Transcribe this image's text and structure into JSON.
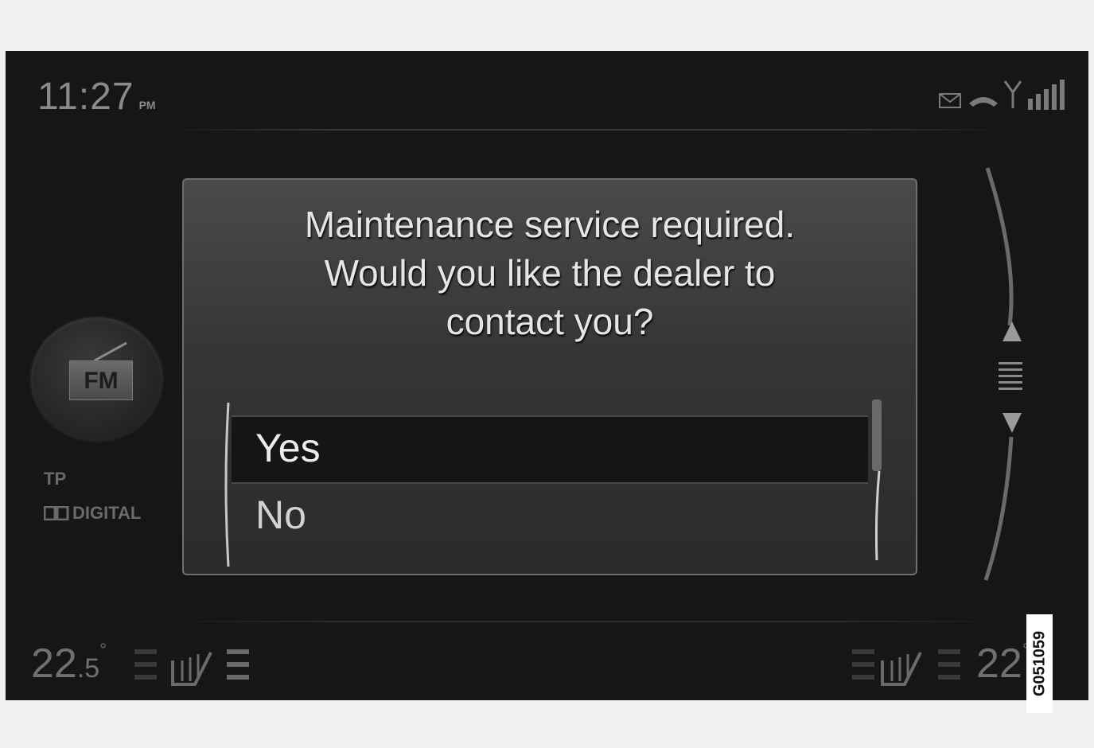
{
  "status_bar": {
    "time": "11:27",
    "ampm": "PM",
    "icons": [
      "message-icon",
      "phone-icon",
      "antenna-icon",
      "signal-bars-icon"
    ]
  },
  "source": {
    "band": "FM",
    "tp": "TP",
    "digital": "DIGITAL",
    "icon": "radio-antenna-icon"
  },
  "dialog": {
    "message_lines": [
      "Maintenance service required.",
      "Would you like the dealer to",
      "contact you?"
    ],
    "options": [
      {
        "label": "Yes",
        "selected": true
      },
      {
        "label": "No",
        "selected": false
      }
    ]
  },
  "climate": {
    "left_temp_int": "22",
    "left_temp_dec": ".5",
    "left_unit": "°",
    "right_temp_int": "22",
    "right_unit": "°",
    "seat_heat_icon": "seat-heater-icon"
  },
  "image_code": "G051059",
  "colors": {
    "screen_bg": "#161616",
    "frame_bg": "#f1f1f1",
    "dialog_border": "#6e6e6e",
    "selected_row": "#151515"
  }
}
